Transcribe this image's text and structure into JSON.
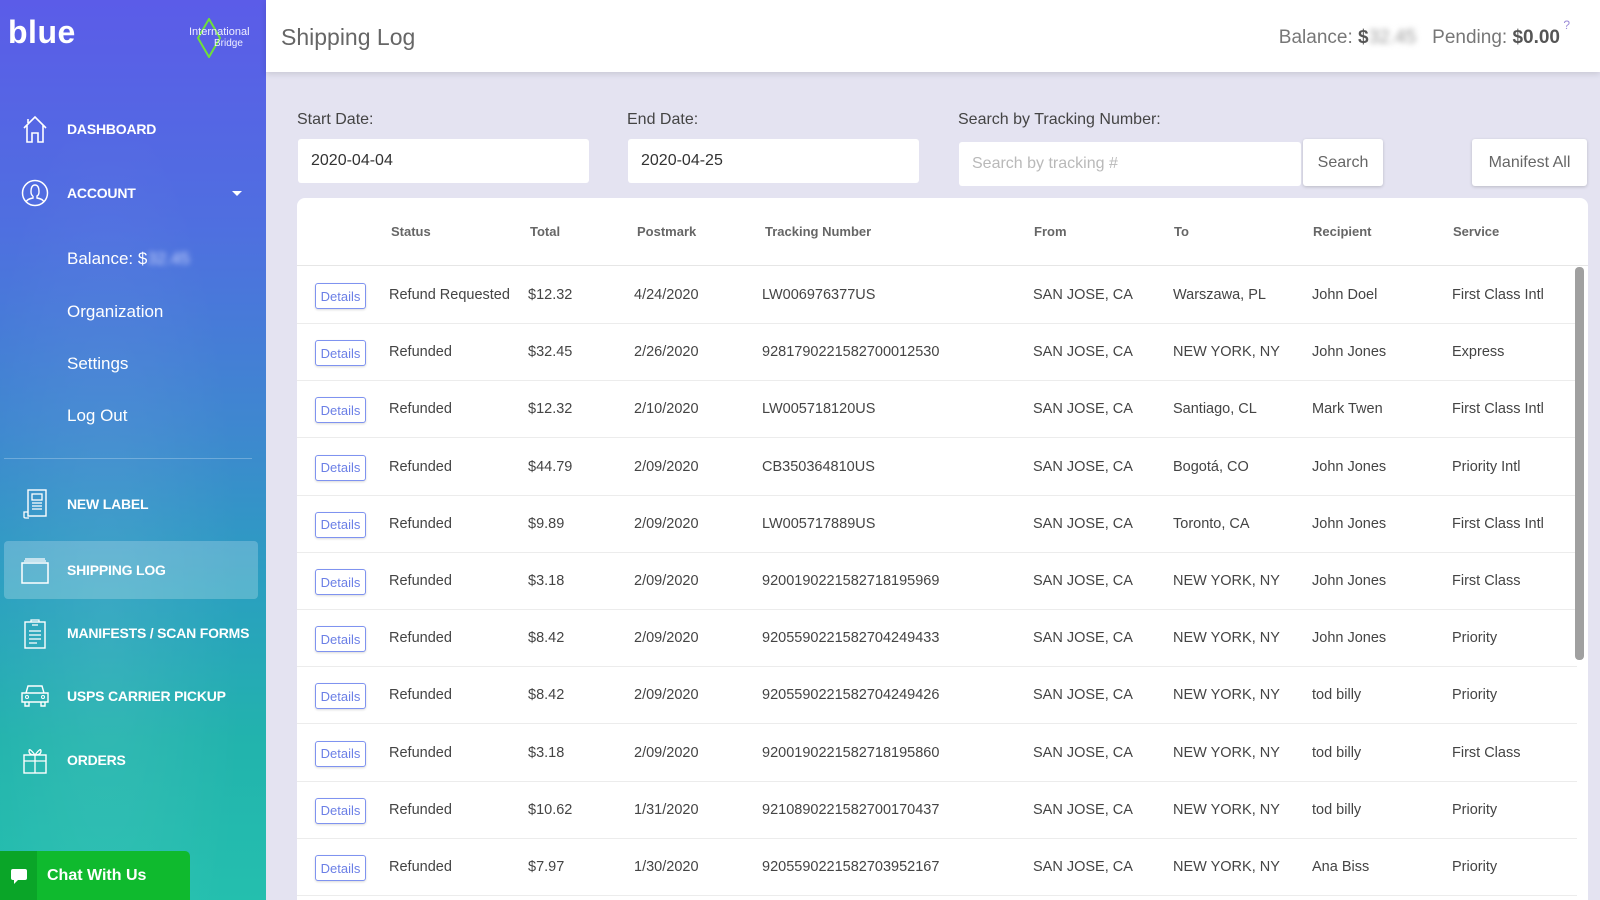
{
  "brand": {
    "name": "blue",
    "partner_line1": "International",
    "partner_line2": "Bridge"
  },
  "header": {
    "title": "Shipping Log",
    "balance_label": "Balance:",
    "balance_currency": "$",
    "balance_value_blurred": "32.45",
    "pending_label": "Pending:",
    "pending_value": "$0.00",
    "help_icon": "?"
  },
  "sidebar": {
    "items": [
      {
        "label": "DASHBOARD",
        "icon": "home-icon"
      },
      {
        "label": "ACCOUNT",
        "icon": "user-circle-icon",
        "expanded": true
      },
      {
        "label": "NEW LABEL",
        "icon": "label-document-icon"
      },
      {
        "label": "SHIPPING LOG",
        "icon": "log-stack-icon",
        "active": true
      },
      {
        "label": "MANIFESTS / SCAN FORMS",
        "icon": "clipboard-icon"
      },
      {
        "label": "USPS CARRIER PICKUP",
        "icon": "car-icon"
      },
      {
        "label": "ORDERS",
        "icon": "gift-icon"
      }
    ],
    "account_sub": {
      "balance_label": "Balance: $",
      "balance_value_blurred": "32.45",
      "organization": "Organization",
      "settings": "Settings",
      "logout": "Log Out"
    }
  },
  "chat": {
    "label": "Chat With Us"
  },
  "filters": {
    "start_label": "Start Date:",
    "start_value": "2020-04-04",
    "end_label": "End Date:",
    "end_value": "2020-04-25",
    "search_label": "Search by Tracking Number:",
    "search_placeholder": "Search by tracking #",
    "search_value": "",
    "search_button": "Search",
    "manifest_button": "Manifest All"
  },
  "table": {
    "columns": [
      "Status",
      "Total",
      "Postmark",
      "Tracking Number",
      "From",
      "To",
      "Recipient",
      "Service"
    ],
    "details_label": "Details",
    "rows": [
      {
        "status": "Refund Requested",
        "total": "$12.32",
        "postmark": "4/24/2020",
        "tracking": "LW006976377US",
        "from": "SAN JOSE, CA",
        "to": "Warszawa, PL",
        "recipient": "John Doel",
        "service": "First Class Intl"
      },
      {
        "status": "Refunded",
        "total": "$32.45",
        "postmark": "2/26/2020",
        "tracking": "9281790221582700012530",
        "from": "SAN JOSE, CA",
        "to": "NEW YORK, NY",
        "recipient": "John Jones",
        "service": "Express"
      },
      {
        "status": "Refunded",
        "total": "$12.32",
        "postmark": "2/10/2020",
        "tracking": "LW005718120US",
        "from": "SAN JOSE, CA",
        "to": "Santiago, CL",
        "recipient": "Mark Twen",
        "service": "First Class Intl"
      },
      {
        "status": "Refunded",
        "total": "$44.79",
        "postmark": "2/09/2020",
        "tracking": "CB350364810US",
        "from": "SAN JOSE, CA",
        "to": "Bogotá, CO",
        "recipient": "John Jones",
        "service": "Priority Intl"
      },
      {
        "status": "Refunded",
        "total": "$9.89",
        "postmark": "2/09/2020",
        "tracking": "LW005717889US",
        "from": "SAN JOSE, CA",
        "to": "Toronto, CA",
        "recipient": "John Jones",
        "service": "First Class Intl"
      },
      {
        "status": "Refunded",
        "total": "$3.18",
        "postmark": "2/09/2020",
        "tracking": "9200190221582718195969",
        "from": "SAN JOSE, CA",
        "to": "NEW YORK, NY",
        "recipient": "John Jones",
        "service": "First Class"
      },
      {
        "status": "Refunded",
        "total": "$8.42",
        "postmark": "2/09/2020",
        "tracking": "9205590221582704249433",
        "from": "SAN JOSE, CA",
        "to": "NEW YORK, NY",
        "recipient": "John Jones",
        "service": "Priority"
      },
      {
        "status": "Refunded",
        "total": "$8.42",
        "postmark": "2/09/2020",
        "tracking": "9205590221582704249426",
        "from": "SAN JOSE, CA",
        "to": "NEW YORK, NY",
        "recipient": "tod billy",
        "service": "Priority"
      },
      {
        "status": "Refunded",
        "total": "$3.18",
        "postmark": "2/09/2020",
        "tracking": "9200190221582718195860",
        "from": "SAN JOSE, CA",
        "to": "NEW YORK, NY",
        "recipient": "tod billy",
        "service": "First Class"
      },
      {
        "status": "Refunded",
        "total": "$10.62",
        "postmark": "1/31/2020",
        "tracking": "9210890221582700170437",
        "from": "SAN JOSE, CA",
        "to": "NEW YORK, NY",
        "recipient": "tod billy",
        "service": "Priority"
      },
      {
        "status": "Refunded",
        "total": "$7.97",
        "postmark": "1/30/2020",
        "tracking": "9205590221582703952167",
        "from": "SAN JOSE, CA",
        "to": "NEW YORK, NY",
        "recipient": "Ana Biss",
        "service": "Priority"
      }
    ]
  },
  "colors": {
    "sidebar_top": "#5b5ce8",
    "sidebar_bottom": "#24bfae",
    "chat_green": "#0fba2e",
    "details_blue": "#6b7fe6",
    "page_bg": "#e4e3f1"
  }
}
